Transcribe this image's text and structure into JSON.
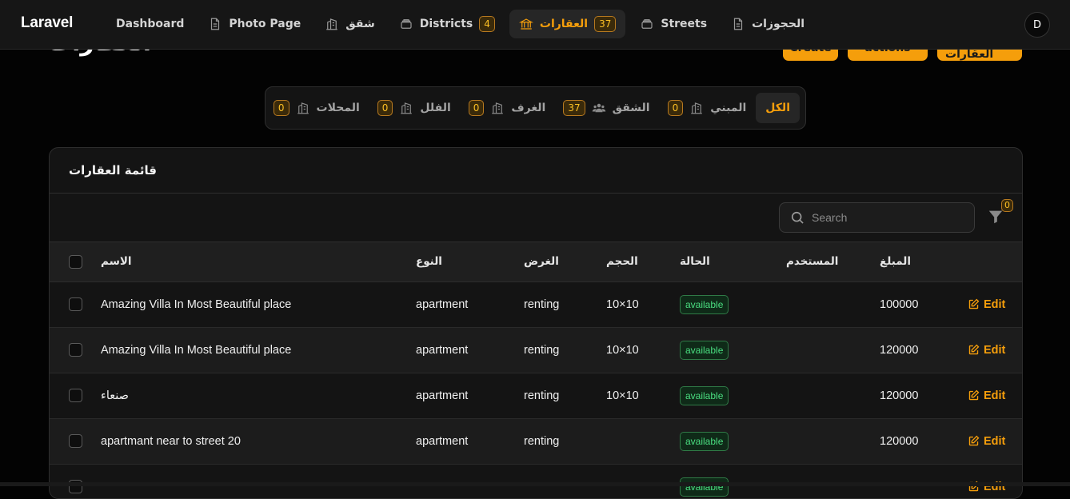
{
  "brand": "Laravel",
  "nav": [
    {
      "label": "Dashboard",
      "icon": "none",
      "badge": null,
      "active": false
    },
    {
      "label": "Photo Page",
      "icon": "document-icon",
      "badge": null,
      "active": false
    },
    {
      "label": "شقق",
      "icon": "building-icon",
      "badge": null,
      "active": false
    },
    {
      "label": "Districts",
      "icon": "stack-icon",
      "badge": "4",
      "active": false
    },
    {
      "label": "العقارات",
      "icon": "bank-icon",
      "badge": "37",
      "active": true
    },
    {
      "label": "Streets",
      "icon": "stack-icon",
      "badge": null,
      "active": false
    },
    {
      "label": "الحجوزات",
      "icon": "document-icon",
      "badge": null,
      "active": false
    }
  ],
  "avatar_initial": "D",
  "page_title": "العقارات",
  "header_buttons": [
    "New العقارات",
    "actions",
    "Create"
  ],
  "tabs": [
    {
      "label": "الكل",
      "badge": null,
      "icon": "none",
      "active": true
    },
    {
      "label": "المبني",
      "badge": "0",
      "icon": "building-icon",
      "active": false
    },
    {
      "label": "الشقق",
      "badge": "37",
      "icon": "users-icon",
      "active": false
    },
    {
      "label": "الغرف",
      "badge": "0",
      "icon": "building-icon",
      "active": false
    },
    {
      "label": "الفلل",
      "badge": "0",
      "icon": "building-icon",
      "active": false
    },
    {
      "label": "المحلات",
      "badge": "0",
      "icon": "building-icon",
      "active": false
    }
  ],
  "card_title": "قائمة العقارات",
  "search_placeholder": "Search",
  "filter_badge": "0",
  "columns": [
    "الاسم",
    "النوع",
    "الغرض",
    "الحجم",
    "الحالة",
    "المستخدم",
    "المبلغ"
  ],
  "edit_label": "Edit",
  "rows": [
    {
      "name": "Amazing Villa In Most Beautiful place",
      "type": "apartment",
      "purpose": "renting",
      "size": "10×10",
      "status": "available",
      "user": "",
      "amount": "100000"
    },
    {
      "name": "Amazing Villa In Most Beautiful place",
      "type": "apartment",
      "purpose": "renting",
      "size": "10×10",
      "status": "available",
      "user": "",
      "amount": "120000"
    },
    {
      "name": "صنعاء",
      "type": "apartment",
      "purpose": "renting",
      "size": "10×10",
      "status": "available",
      "user": "",
      "amount": "120000"
    },
    {
      "name": "apartmant near to street 20",
      "type": "apartment",
      "purpose": "renting",
      "size": "",
      "status": "available",
      "user": "",
      "amount": "120000"
    },
    {
      "name": "",
      "type": "",
      "purpose": "",
      "size": "",
      "status": "available",
      "user": "",
      "amount": ""
    }
  ],
  "colors": {
    "accent": "#f59e0b",
    "status_green": "#4ade80",
    "background": "#030303"
  }
}
